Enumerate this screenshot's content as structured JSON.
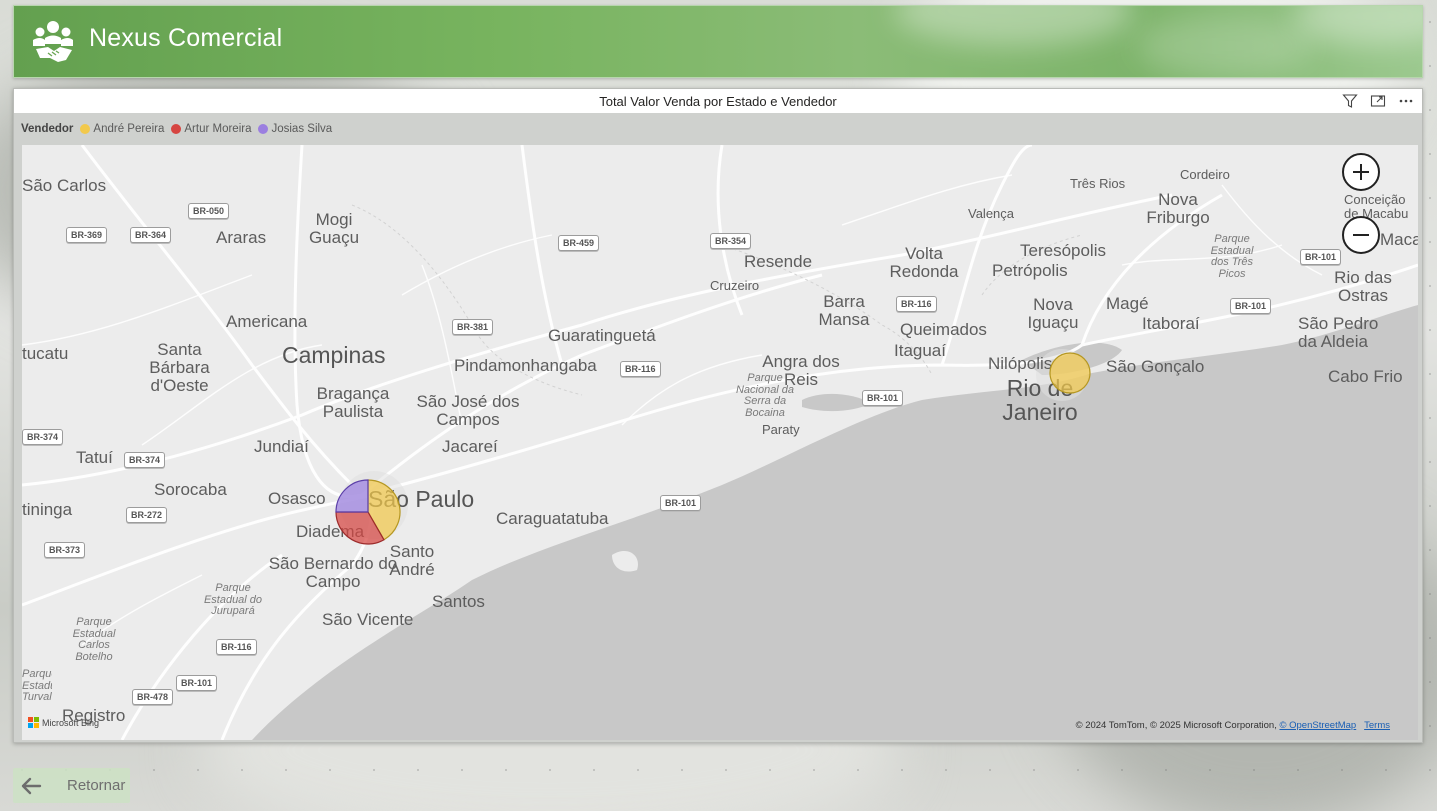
{
  "app": {
    "title": "Nexus Comercial"
  },
  "visual": {
    "title": "Total Valor Venda por Estado e Vendedor",
    "header_icons": [
      "filter-icon",
      "focus-mode-icon",
      "more-options-icon"
    ]
  },
  "legend": {
    "title": "Vendedor",
    "items": [
      {
        "label": "André Pereira",
        "color": "#f2c94c"
      },
      {
        "label": "Artur Moreira",
        "color": "#d64541"
      },
      {
        "label": "Josias Silva",
        "color": "#9b7fe0"
      }
    ]
  },
  "map": {
    "cities": [
      "São Carlos",
      "Mogi Guaçu",
      "Araras",
      "Americana",
      "Campinas",
      "Santa Bárbara d'Oeste",
      "Bragança Paulista",
      "Jundiaí",
      "Tatuí",
      "Sorocaba",
      "Osasco",
      "São Paulo",
      "Diadema",
      "Santo André",
      "São Bernardo do Campo",
      "Santos",
      "São Vicente",
      "Registro",
      "tucatu",
      "tininga",
      "São José dos Campos",
      "Jacareí",
      "Pindamonhangaba",
      "Guaratinguetá",
      "Caraguatatuba",
      "Cruzeiro",
      "Resende",
      "Barra Mansa",
      "Volta Redonda",
      "Angra dos Reis",
      "Paraty",
      "Queimados",
      "Itaguaí",
      "Nova Iguaçu",
      "Nilópolis",
      "Rio de Janeiro",
      "São Gonçalo",
      "Teresópolis",
      "Petrópolis",
      "Magé",
      "Itaboraí",
      "Valença",
      "Três Rios",
      "Cordeiro",
      "Nova Friburgo",
      "Conceição de Macabu",
      "Macaé",
      "Rio das Ostras",
      "São Pedro da Aldeia",
      "Cabo Frio"
    ],
    "parks": [
      "Parque Estadual dos Três Picos",
      "Parque Nacional da Serra da Bocaina",
      "Parque Estadual do Jurupará",
      "Parque Estadual Carlos Botelho",
      "Parque Estadual Turvales"
    ],
    "highways": [
      "BR-050",
      "BR-369",
      "BR-364",
      "BR-459",
      "BR-354",
      "BR-381",
      "BR-116",
      "BR-101",
      "BR-374",
      "BR-272",
      "BR-373",
      "BR-478"
    ],
    "zoom_in_icon": "plus-icon",
    "zoom_out_icon": "minus-icon",
    "attribution": "© 2024 TomTom, © 2025 Microsoft Corporation,",
    "osm_link": "© OpenStreetMap",
    "terms_link": "Terms",
    "bing_label": "Microsoft Bing"
  },
  "chart_data": {
    "type": "pie",
    "title": "Total Valor Venda por Estado e Vendedor",
    "legend_title": "Vendedor",
    "series": [
      "André Pereira",
      "Artur Moreira",
      "Josias Silva"
    ],
    "locations": [
      {
        "name": "São Paulo",
        "slices": [
          {
            "series": "André Pereira",
            "value": 0.417
          },
          {
            "series": "Artur Moreira",
            "value": 0.333
          },
          {
            "series": "Josias Silva",
            "value": 0.25
          }
        ]
      },
      {
        "name": "Rio de Janeiro",
        "slices": [
          {
            "series": "André Pereira",
            "value": 1.0
          }
        ]
      }
    ]
  },
  "footer": {
    "return_label": "Retornar"
  }
}
